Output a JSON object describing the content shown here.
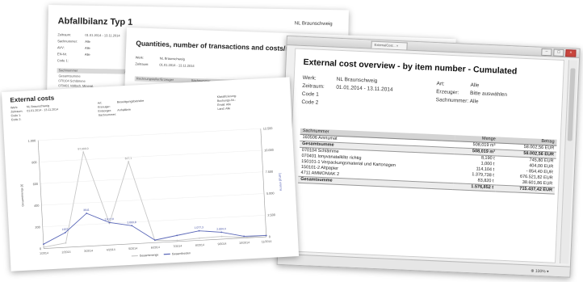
{
  "doc1": {
    "title": "Abfallbilanz Typ 1",
    "org": "NL Braunschweig",
    "fields": [
      {
        "label": "Zeitraum:",
        "value": "01.01.2014 - 13.11.2014"
      },
      {
        "label": "Sachnummer:",
        "value": "Alle"
      },
      {
        "label": "AVV:",
        "value": "Alle"
      },
      {
        "label": "EN-Nr.",
        "value": "Alle"
      },
      {
        "label": "Code 1:",
        "value": ""
      }
    ],
    "table_header": [
      "Sachnummer",
      "AVV"
    ],
    "rows": [
      "Gesamtsumme",
      "070104 Schlämme",
      "070401 Vollbeh. Mineral.",
      "150101-1 Verpackung",
      "150101-2 Altpapier"
    ]
  },
  "doc2": {
    "title": "Quantities, number of transactions and costs/revenues per accounting office/disposer",
    "fields": [
      {
        "label": "Werk:",
        "value": "NL Braunschweig"
      },
      {
        "label": "Zeitraum:",
        "value": "01.01.2014 - 13.11.2014"
      }
    ],
    "table_header": [
      "Rechnungsteller/Erzeuger",
      "Sachnummer",
      "Menge",
      "Anz",
      "Erlös"
    ]
  },
  "window": {
    "tab_label": "ExternalCost... ×",
    "buttons": [
      "–",
      "□",
      "×"
    ],
    "zoom": "⊕ 100% ▾"
  },
  "doc3": {
    "title": "External cost overview - by item number - Cumulated",
    "left_fields": [
      {
        "label": "Werk:",
        "value": "NL Braunschweig"
      },
      {
        "label": "Zeitraum:",
        "value": "01.01.2014 - 13.11.2014"
      },
      {
        "label": "Code 1",
        "value": ""
      },
      {
        "label": "Code 2",
        "value": ""
      }
    ],
    "right_fields": [
      {
        "label": "Art:",
        "value": "Alle"
      },
      {
        "label": "Erzeuger:",
        "value": "Bitte auswählen"
      },
      {
        "label": "Sachnummer:",
        "value": "Alle"
      }
    ],
    "columns": [
      "Sachnummer",
      "Menge",
      "Betrag"
    ],
    "rows": [
      {
        "item": "160506 Amnumat",
        "qty": "508,019 m³",
        "amount": "58.002,56 EUR",
        "sum": false
      },
      {
        "item": "Gesamtsumme",
        "qty": "508,019 m³",
        "amount": "58.002,56 EUR",
        "sum": true
      },
      {
        "item": "070104 Schlämme",
        "qty": "8,190 t",
        "amount": "745,80 EUR",
        "sum": false
      },
      {
        "item": "070401 Ionyvanatalklite richtig",
        "qty": "1,000 t",
        "amount": "404,00 EUR",
        "sum": false
      },
      {
        "item": "150101-1 Verpackungsmaterial und Kartonagen",
        "qty": "114,104 t",
        "amount": "- 854,40 EUR",
        "sum": false
      },
      {
        "item": "150101-2 Altpapier",
        "qty": "1.379,738 t",
        "amount": "676.521,82 EUR",
        "sum": false
      },
      {
        "item": "4711 AMMONIAK 2",
        "qty": "83,820 t",
        "amount": "38.601,86 EUR",
        "sum": false
      },
      {
        "item": "Gesamtsumme",
        "qty": "1.576,852 t",
        "amount": "715.437,42 EUR",
        "sum": true
      }
    ]
  },
  "chartdoc": {
    "title": "External costs",
    "meta_left": [
      "Werk:",
      "Zeitraum:",
      "Code 1:",
      "Code 2:"
    ],
    "meta_left_values": [
      "NL Braunschweig",
      "01.01.2014 - 13.11.2014",
      "",
      ""
    ],
    "meta_mid": [
      "Art:",
      "Erzeuger:",
      "Entsorger:",
      "Sachnummer:"
    ],
    "meta_mid_values": [
      "Beseitigungsbetriebe",
      "",
      "Anhaltlinie",
      ""
    ],
    "meta_right": [
      "Klassifizierung:",
      "Buchungs-Nr.:",
      "Email: Alle",
      "Land: Alle"
    ]
  },
  "chart_data": {
    "type": "line",
    "title": "",
    "x": [
      "1/2014",
      "2/2014",
      "3/2014",
      "4/2014",
      "5/2014",
      "6/2014",
      "7/2014",
      "8/2014",
      "9/2014",
      "10/2014",
      "11/2014"
    ],
    "y_left_ticks": [
      "0",
      "200",
      "400",
      "600",
      "800",
      "1.000"
    ],
    "y_right_ticks": [
      "0",
      "2.500",
      "5.000",
      "7.500",
      "10.000",
      "12.500"
    ],
    "ylim_left": [
      0,
      1000
    ],
    "ylim_right": [
      0,
      12500
    ],
    "ylabel_left": "Gesamtmenge [t]",
    "ylabel_right": "Kosten [EUR]",
    "series": [
      {
        "name": "Gesamtmenge",
        "axis": "left",
        "color": "#c8c8c8",
        "values": [
          12,
          40,
          870,
          200,
          760,
          20,
          10,
          20,
          25,
          5,
          15
        ]
      },
      {
        "name": "Gesamtkosten",
        "axis": "right",
        "color": "#5a67b8",
        "values": [
          500,
          1700,
          3800,
          2600,
          2100,
          300,
          700,
          1100,
          800,
          200,
          150
        ]
      }
    ],
    "data_labels": [
      {
        "series": 0,
        "i": 2,
        "text": "87.000,0"
      },
      {
        "series": 0,
        "i": 4,
        "text": "617,1"
      },
      {
        "series": 1,
        "i": 2,
        "text": "3641"
      },
      {
        "series": 1,
        "i": 1,
        "text": "1637"
      },
      {
        "series": 1,
        "i": 3,
        "text": "2.617,8"
      },
      {
        "series": 1,
        "i": 4,
        "text": "2.093,8"
      },
      {
        "series": 1,
        "i": 7,
        "text": "1.077,3"
      },
      {
        "series": 1,
        "i": 8,
        "text": "2.004,4"
      }
    ],
    "legend": "bottom-center"
  }
}
